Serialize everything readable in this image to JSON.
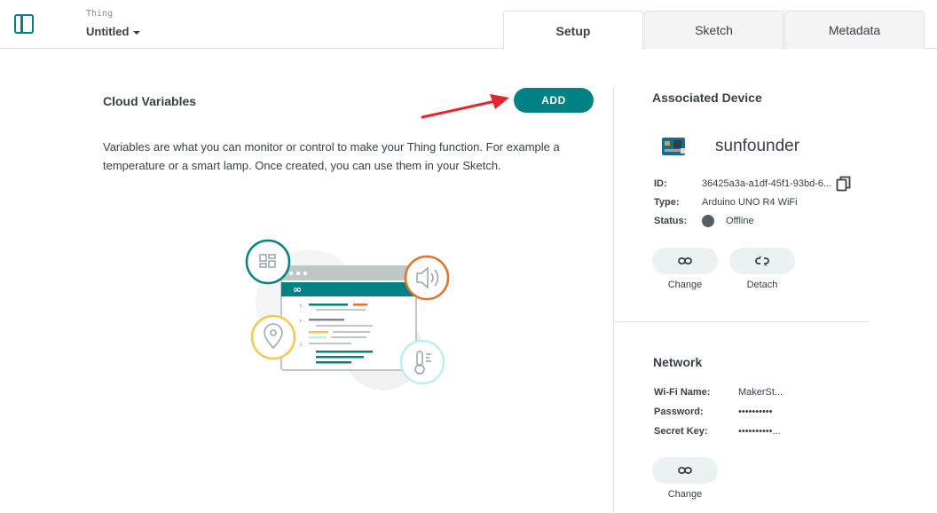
{
  "header": {
    "thing_label": "Thing",
    "thing_name": "Untitled",
    "tabs": [
      {
        "label": "Setup",
        "active": true
      },
      {
        "label": "Sketch",
        "active": false
      },
      {
        "label": "Metadata",
        "active": false
      }
    ]
  },
  "cloud_variables": {
    "title": "Cloud Variables",
    "add_label": "ADD",
    "description": "Variables are what you can monitor or control to make your Thing function. For example a temperature or a smart lamp. Once created, you can use them in your Sketch."
  },
  "associated_device": {
    "title": "Associated Device",
    "name": "sunfounder",
    "id_label": "ID:",
    "id_value": "36425a3a-a1df-45f1-93bd-6...",
    "type_label": "Type:",
    "type_value": "Arduino UNO R4 WiFi",
    "status_label": "Status:",
    "status_value": "Offline",
    "change_label": "Change",
    "detach_label": "Detach"
  },
  "network": {
    "title": "Network",
    "wifi_label": "Wi-Fi Name:",
    "wifi_value": "MakerSt...",
    "password_label": "Password:",
    "password_value": "••••••••••",
    "secret_label": "Secret Key:",
    "secret_value": "••••••••••...",
    "change_label": "Change"
  },
  "colors": {
    "accent": "#008184",
    "annotation_arrow": "#e8232e",
    "status_offline": "#555f63"
  },
  "icons": {
    "sidebar": "sidebar-toggle-icon",
    "copy": "copy-icon",
    "link": "link-icon",
    "unlink": "unlink-icon"
  }
}
